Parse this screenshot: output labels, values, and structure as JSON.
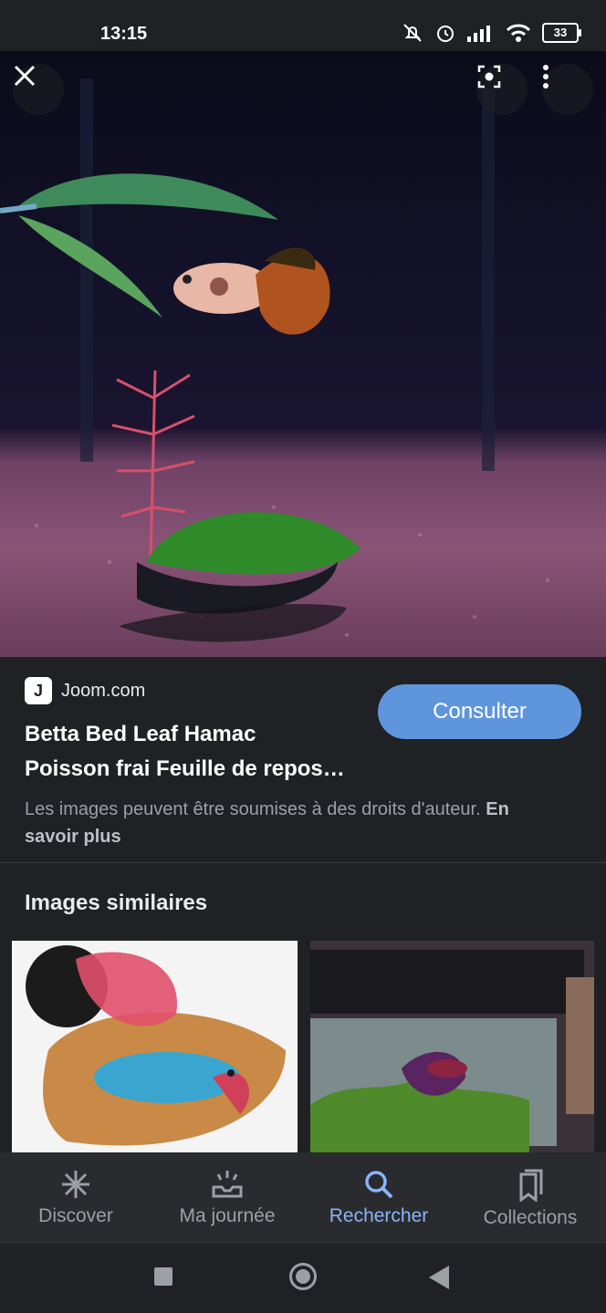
{
  "status_bar": {
    "time": "13:15",
    "battery": "33"
  },
  "hero": {
    "close_icon": "close-icon",
    "lens_icon": "lens-icon",
    "more_icon": "more-vert-icon"
  },
  "source": {
    "site": "Joom.com",
    "favicon_letter": "J"
  },
  "result": {
    "title_line1": "Betta Bed Leaf Hamac",
    "title_line2": "Poisson frai Feuille de repos…",
    "consult_label": "Consulter",
    "rights_text": "Les images peuvent être soumises à des droits d'auteur.",
    "rights_link": "En savoir plus"
  },
  "similar": {
    "title": "Images similaires"
  },
  "bottom_nav": {
    "items": [
      {
        "label": "Discover",
        "icon": "asterisk-icon"
      },
      {
        "label": "Ma journée",
        "icon": "inbox-icon"
      },
      {
        "label": "Rechercher",
        "icon": "search-icon"
      },
      {
        "label": "Collections",
        "icon": "collections-icon"
      }
    ],
    "active": "Rechercher"
  },
  "colors": {
    "accent": "#8ab4f8",
    "button": "#5f95dc",
    "background": "#202124"
  }
}
